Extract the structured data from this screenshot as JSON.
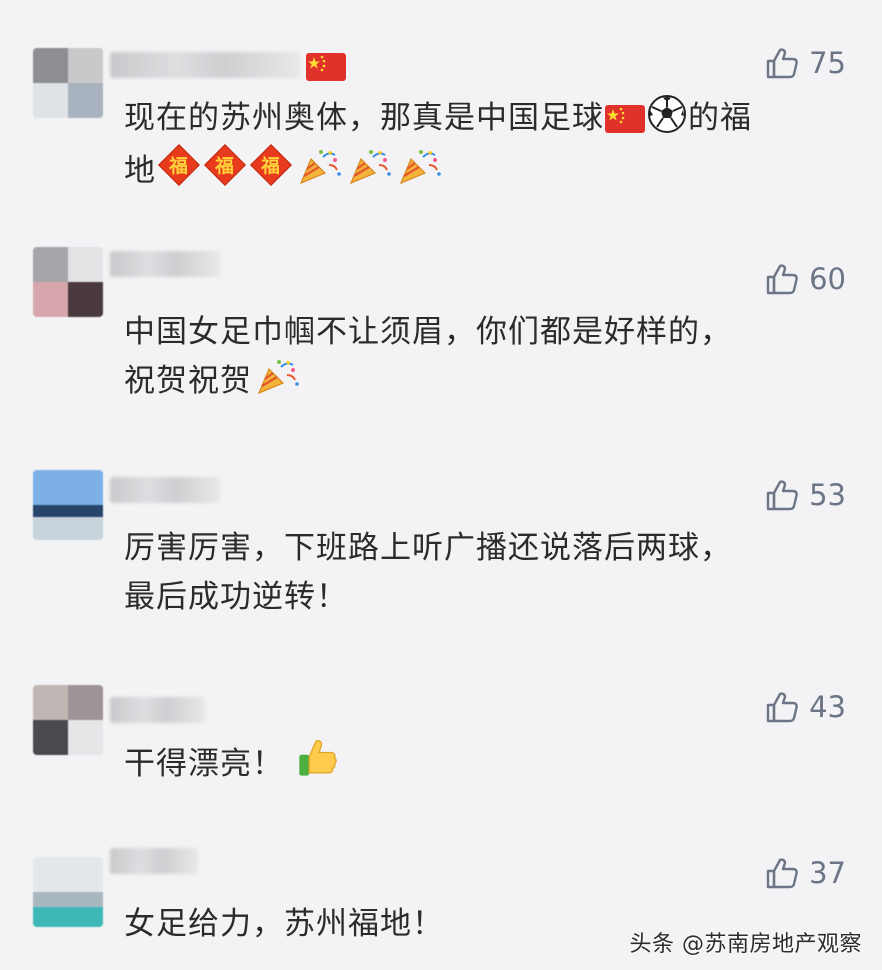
{
  "comments": [
    {
      "likes": "75",
      "text_line1": "现在的苏州奥体，那真是中国足球",
      "text_line1_tail": "的福",
      "text_line2": "地"
    },
    {
      "likes": "60",
      "text_line1": "中国女足巾帼不让须眉，你们都是好样的，",
      "text_line2": "祝贺祝贺"
    },
    {
      "likes": "53",
      "text_line1": "厉害厉害，下班路上听广播还说落后两球，",
      "text_line2": "最后成功逆转！"
    },
    {
      "likes": "43",
      "text_line1": "干得漂亮！"
    },
    {
      "likes": "37",
      "text_line1": "女足给力，苏州福地！"
    }
  ],
  "icons": {
    "like": "thumbs-up-outline-icon",
    "flag": "china-flag-icon",
    "ball": "soccer-ball-icon",
    "fu": "fu-diamond-icon",
    "party": "party-popper-icon",
    "thumb": "thumbs-up-emoji-icon"
  },
  "colors": {
    "background": "#f3f3f5",
    "like_gray": "#6b7585",
    "text": "#2b2b2b"
  },
  "watermark": "头条 @苏南房地产观察"
}
